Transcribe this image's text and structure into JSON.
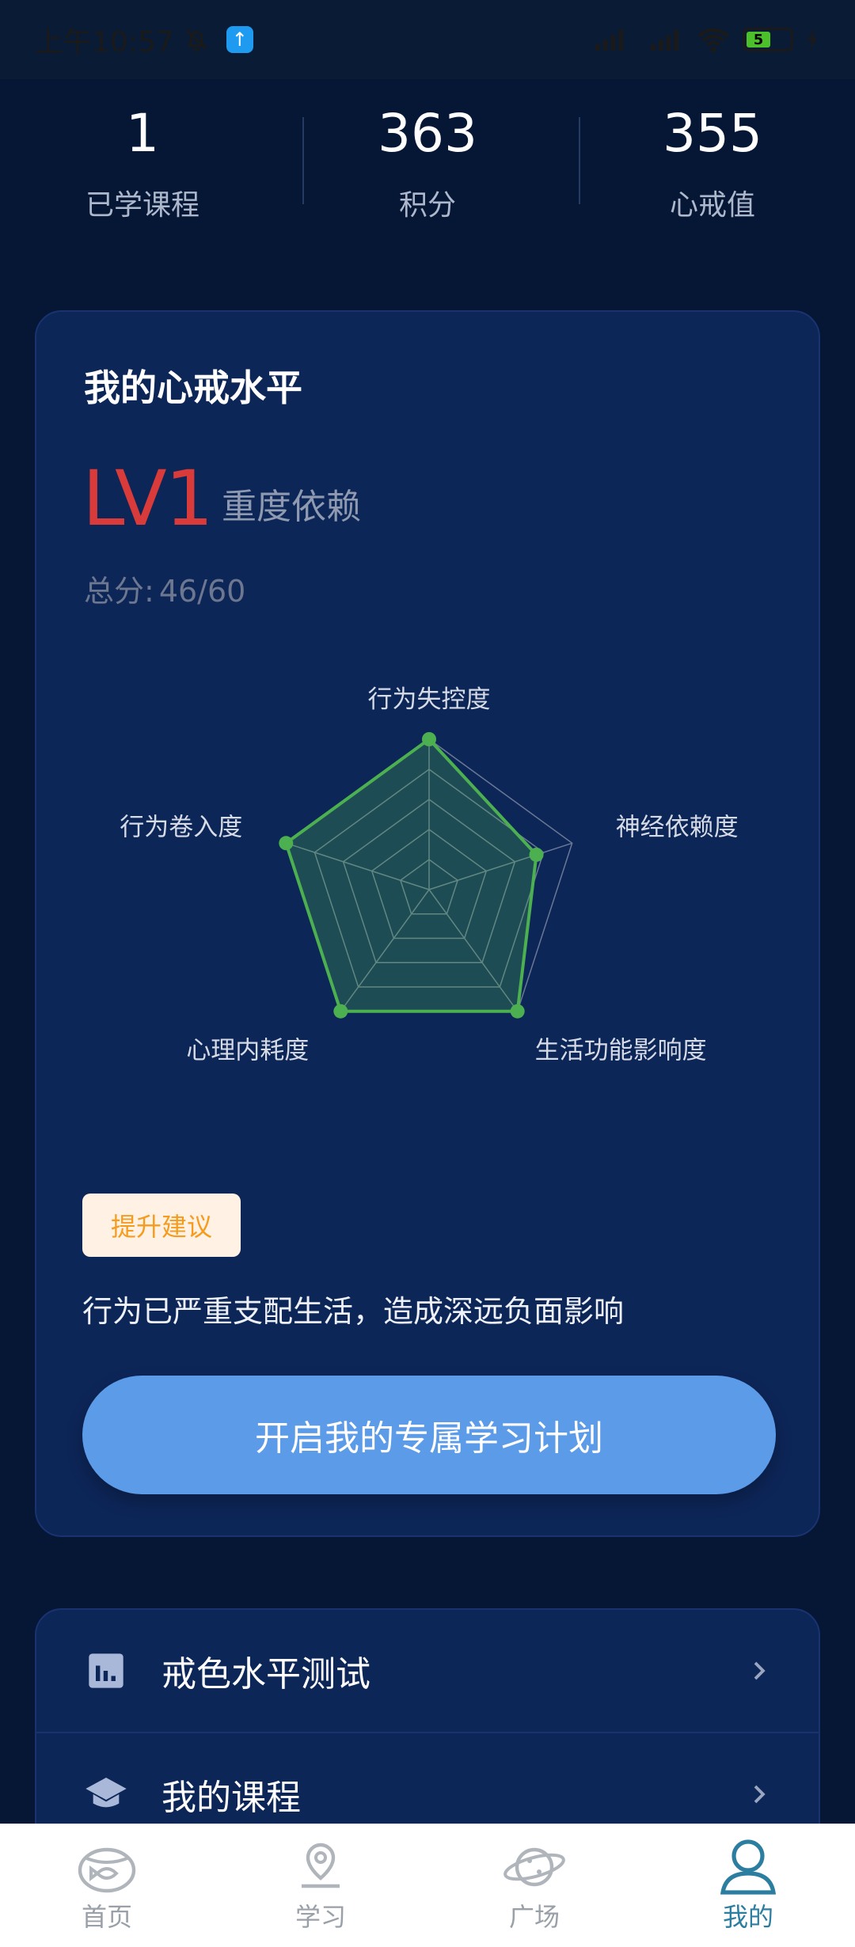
{
  "status_bar": {
    "time": "上午10:57",
    "battery_level": "5"
  },
  "stats": [
    {
      "value": "1",
      "label": "已学课程"
    },
    {
      "value": "363",
      "label": "积分"
    },
    {
      "value": "355",
      "label": "心戒值"
    }
  ],
  "level_card": {
    "title": "我的心戒水平",
    "level": "LV1",
    "level_desc": "重度依赖",
    "total_label": "总分:",
    "total_value": "46/60",
    "radar": {
      "axes": [
        "行为失控度",
        "神经依赖度",
        "生活功能影响度",
        "心理内耗度",
        "行为卷入度"
      ],
      "scores": [
        10,
        7.5,
        10,
        10,
        10
      ],
      "max": 10,
      "accent_color": "#4caf50"
    },
    "tag": "提升建议",
    "advice": "行为已严重支配生活，造成深远负面影响",
    "cta_label": "开启我的专属学习计划"
  },
  "menu": [
    {
      "icon": "bar-chart-icon",
      "label": "戒色水平测试"
    },
    {
      "icon": "graduation-cap-icon",
      "label": "我的课程"
    }
  ],
  "tabs": [
    {
      "icon": "fishbowl-icon",
      "label": "首页",
      "active": false
    },
    {
      "icon": "map-pin-icon",
      "label": "学习",
      "active": false
    },
    {
      "icon": "planet-icon",
      "label": "广场",
      "active": false
    },
    {
      "icon": "user-icon",
      "label": "我的",
      "active": true
    }
  ],
  "colors": {
    "background": "#061736",
    "card": "#0d2658",
    "level_red": "#d93a3a",
    "cta_blue": "#5b9be8",
    "tag_orange": "#f59c1f",
    "active_tab": "#2c7ea0"
  }
}
